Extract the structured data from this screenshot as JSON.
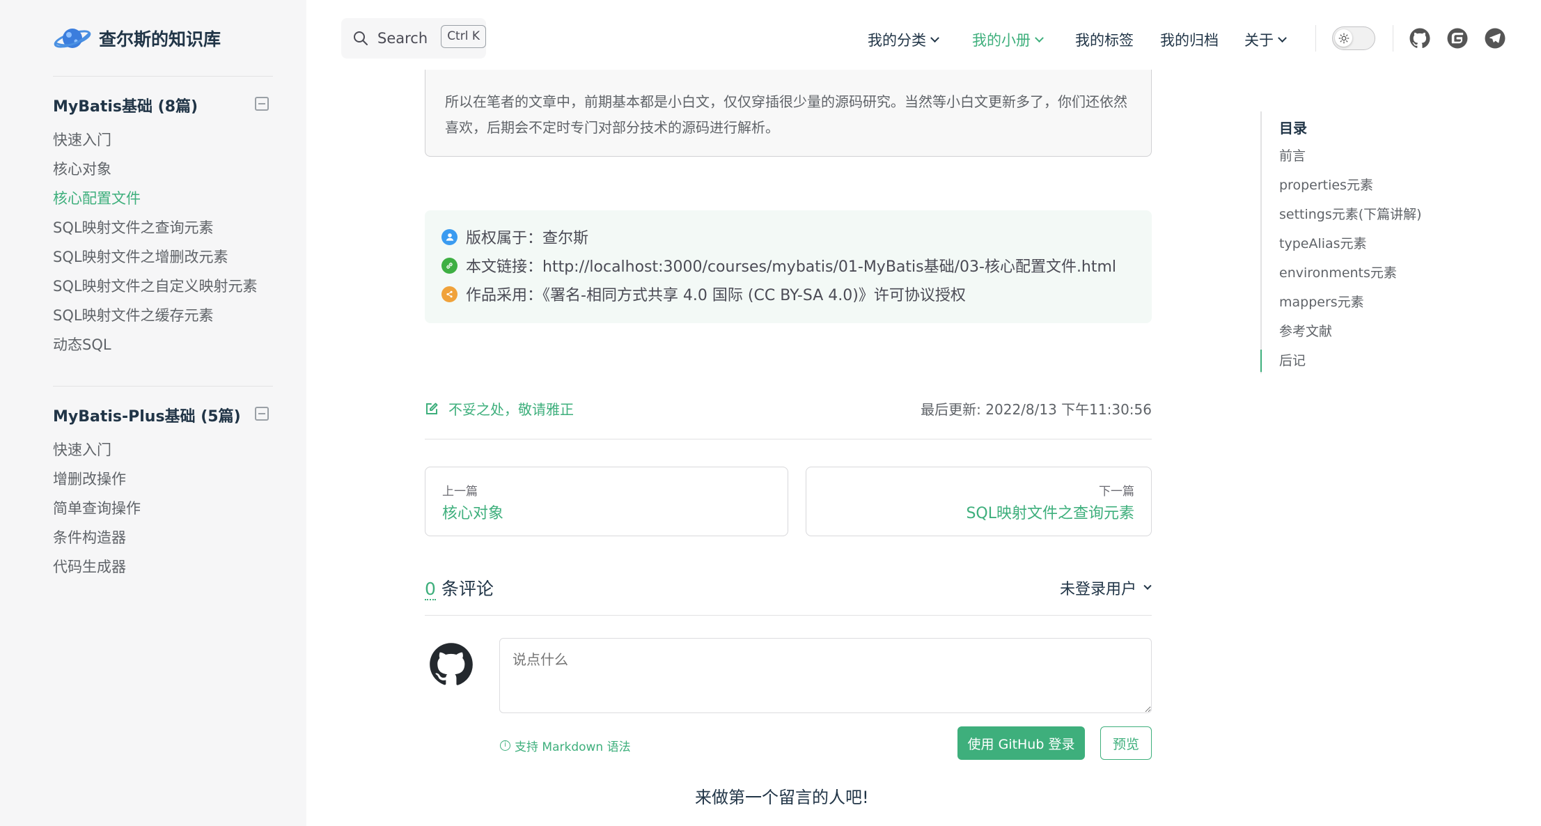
{
  "site": {
    "title": "查尔斯的知识库"
  },
  "search": {
    "label": "Search",
    "shortcut": "Ctrl K"
  },
  "nav": {
    "items": [
      {
        "label": "我的分类",
        "dropdown": true
      },
      {
        "label": "我的小册",
        "dropdown": true,
        "active": true
      },
      {
        "label": "我的标签"
      },
      {
        "label": "我的归档"
      },
      {
        "label": "关于",
        "dropdown": true
      }
    ],
    "social": [
      "github-icon",
      "gitee-icon",
      "telegram-icon"
    ]
  },
  "sidebar": {
    "groups": [
      {
        "title": "MyBatis基础 (8篇)",
        "items": [
          "快速入门",
          "核心对象",
          "核心配置文件",
          "SQL映射文件之查询元素",
          "SQL映射文件之增删改元素",
          "SQL映射文件之自定义映射元素",
          "SQL映射文件之缓存元素",
          "动态SQL"
        ],
        "active": "核心配置文件"
      },
      {
        "title": "MyBatis-Plus基础 (5篇)",
        "items": [
          "快速入门",
          "增删改操作",
          "简单查询操作",
          "条件构造器",
          "代码生成器"
        ]
      }
    ]
  },
  "article": {
    "quote": "所以在笔者的文章中，前期基本都是小白文，仅仅穿插很少量的源码研究。当然等小白文更新多了，你们还依然喜欢，后期会不定时专门对部分技术的源码进行解析。",
    "copyright": {
      "author": "版权属于：查尔斯",
      "link": "本文链接：http://localhost:3000/courses/mybatis/01-MyBatis基础/03-核心配置文件.html",
      "license": "作品采用：《署名-相同方式共享 4.0 国际 (CC BY-SA 4.0)》许可协议授权"
    },
    "edit_link": "不妥之处，敬请雅正",
    "last_updated": "最后更新: 2022/8/13 下午11:30:56",
    "prev": {
      "label": "上一篇",
      "title": "核心对象"
    },
    "next": {
      "label": "下一篇",
      "title": "SQL映射文件之查询元素"
    }
  },
  "comments": {
    "count": "0",
    "count_suffix": " 条评论",
    "user_menu": "未登录用户",
    "placeholder": "说点什么",
    "markdown_hint": "支持 Markdown 语法",
    "login_button": "使用 GitHub 登录",
    "preview_button": "预览",
    "empty_message": "来做第一个留言的人吧!"
  },
  "toc": {
    "title": "目录",
    "items": [
      "前言",
      "properties元素",
      "settings元素(下篇讲解)",
      "typeAlias元素",
      "environments元素",
      "mappers元素",
      "参考文献",
      "后记"
    ],
    "active": "后记"
  },
  "colors": {
    "accent": "#3eaf7c",
    "text": "#213547",
    "muted": "#5f6368"
  }
}
